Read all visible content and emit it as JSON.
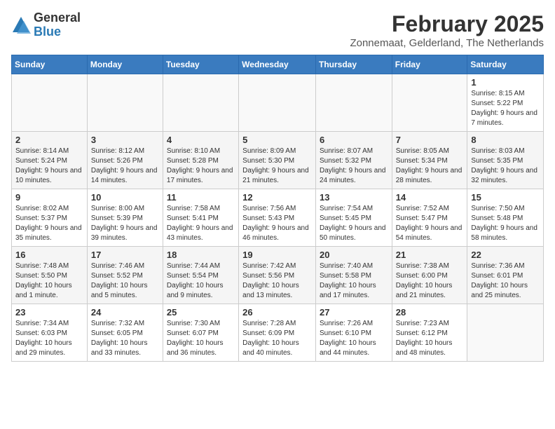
{
  "logo": {
    "general": "General",
    "blue": "Blue"
  },
  "title": "February 2025",
  "subtitle": "Zonnemaat, Gelderland, The Netherlands",
  "headers": [
    "Sunday",
    "Monday",
    "Tuesday",
    "Wednesday",
    "Thursday",
    "Friday",
    "Saturday"
  ],
  "weeks": [
    [
      {
        "day": "",
        "info": ""
      },
      {
        "day": "",
        "info": ""
      },
      {
        "day": "",
        "info": ""
      },
      {
        "day": "",
        "info": ""
      },
      {
        "day": "",
        "info": ""
      },
      {
        "day": "",
        "info": ""
      },
      {
        "day": "1",
        "info": "Sunrise: 8:15 AM\nSunset: 5:22 PM\nDaylight: 9 hours and 7 minutes."
      }
    ],
    [
      {
        "day": "2",
        "info": "Sunrise: 8:14 AM\nSunset: 5:24 PM\nDaylight: 9 hours and 10 minutes."
      },
      {
        "day": "3",
        "info": "Sunrise: 8:12 AM\nSunset: 5:26 PM\nDaylight: 9 hours and 14 minutes."
      },
      {
        "day": "4",
        "info": "Sunrise: 8:10 AM\nSunset: 5:28 PM\nDaylight: 9 hours and 17 minutes."
      },
      {
        "day": "5",
        "info": "Sunrise: 8:09 AM\nSunset: 5:30 PM\nDaylight: 9 hours and 21 minutes."
      },
      {
        "day": "6",
        "info": "Sunrise: 8:07 AM\nSunset: 5:32 PM\nDaylight: 9 hours and 24 minutes."
      },
      {
        "day": "7",
        "info": "Sunrise: 8:05 AM\nSunset: 5:34 PM\nDaylight: 9 hours and 28 minutes."
      },
      {
        "day": "8",
        "info": "Sunrise: 8:03 AM\nSunset: 5:35 PM\nDaylight: 9 hours and 32 minutes."
      }
    ],
    [
      {
        "day": "9",
        "info": "Sunrise: 8:02 AM\nSunset: 5:37 PM\nDaylight: 9 hours and 35 minutes."
      },
      {
        "day": "10",
        "info": "Sunrise: 8:00 AM\nSunset: 5:39 PM\nDaylight: 9 hours and 39 minutes."
      },
      {
        "day": "11",
        "info": "Sunrise: 7:58 AM\nSunset: 5:41 PM\nDaylight: 9 hours and 43 minutes."
      },
      {
        "day": "12",
        "info": "Sunrise: 7:56 AM\nSunset: 5:43 PM\nDaylight: 9 hours and 46 minutes."
      },
      {
        "day": "13",
        "info": "Sunrise: 7:54 AM\nSunset: 5:45 PM\nDaylight: 9 hours and 50 minutes."
      },
      {
        "day": "14",
        "info": "Sunrise: 7:52 AM\nSunset: 5:47 PM\nDaylight: 9 hours and 54 minutes."
      },
      {
        "day": "15",
        "info": "Sunrise: 7:50 AM\nSunset: 5:48 PM\nDaylight: 9 hours and 58 minutes."
      }
    ],
    [
      {
        "day": "16",
        "info": "Sunrise: 7:48 AM\nSunset: 5:50 PM\nDaylight: 10 hours and 1 minute."
      },
      {
        "day": "17",
        "info": "Sunrise: 7:46 AM\nSunset: 5:52 PM\nDaylight: 10 hours and 5 minutes."
      },
      {
        "day": "18",
        "info": "Sunrise: 7:44 AM\nSunset: 5:54 PM\nDaylight: 10 hours and 9 minutes."
      },
      {
        "day": "19",
        "info": "Sunrise: 7:42 AM\nSunset: 5:56 PM\nDaylight: 10 hours and 13 minutes."
      },
      {
        "day": "20",
        "info": "Sunrise: 7:40 AM\nSunset: 5:58 PM\nDaylight: 10 hours and 17 minutes."
      },
      {
        "day": "21",
        "info": "Sunrise: 7:38 AM\nSunset: 6:00 PM\nDaylight: 10 hours and 21 minutes."
      },
      {
        "day": "22",
        "info": "Sunrise: 7:36 AM\nSunset: 6:01 PM\nDaylight: 10 hours and 25 minutes."
      }
    ],
    [
      {
        "day": "23",
        "info": "Sunrise: 7:34 AM\nSunset: 6:03 PM\nDaylight: 10 hours and 29 minutes."
      },
      {
        "day": "24",
        "info": "Sunrise: 7:32 AM\nSunset: 6:05 PM\nDaylight: 10 hours and 33 minutes."
      },
      {
        "day": "25",
        "info": "Sunrise: 7:30 AM\nSunset: 6:07 PM\nDaylight: 10 hours and 36 minutes."
      },
      {
        "day": "26",
        "info": "Sunrise: 7:28 AM\nSunset: 6:09 PM\nDaylight: 10 hours and 40 minutes."
      },
      {
        "day": "27",
        "info": "Sunrise: 7:26 AM\nSunset: 6:10 PM\nDaylight: 10 hours and 44 minutes."
      },
      {
        "day": "28",
        "info": "Sunrise: 7:23 AM\nSunset: 6:12 PM\nDaylight: 10 hours and 48 minutes."
      },
      {
        "day": "",
        "info": ""
      }
    ]
  ]
}
